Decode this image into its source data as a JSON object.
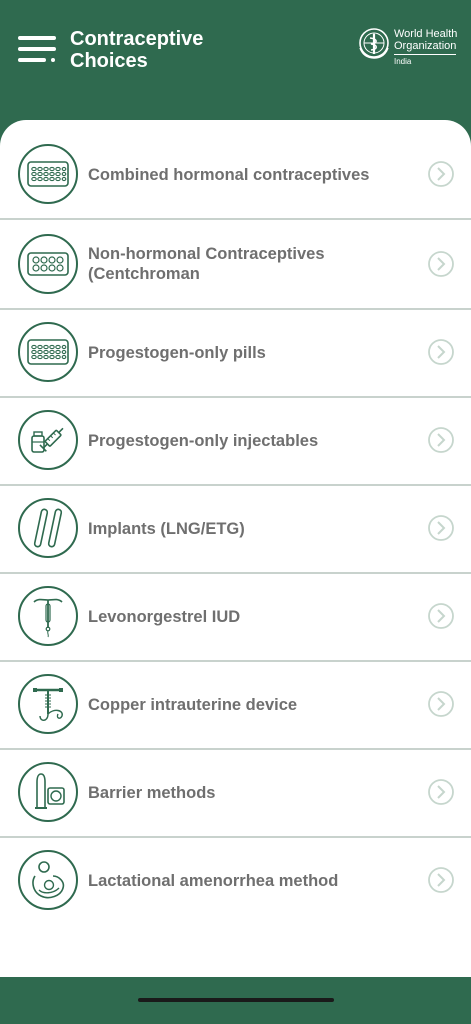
{
  "header": {
    "title_line1": "Contraceptive",
    "title_line2": "Choices",
    "org_name_line1": "World Health",
    "org_name_line2": "Organization",
    "org_country": "India"
  },
  "items": [
    {
      "label": "Combined hormonal contraceptives",
      "icon": "pill-pack-icon"
    },
    {
      "label": "Non-hormonal Contraceptives (Centchroman",
      "icon": "tablet-strip-icon"
    },
    {
      "label": "Progestogen-only pills",
      "icon": "pill-pack-icon"
    },
    {
      "label": "Progestogen-only injectables",
      "icon": "syringe-vial-icon"
    },
    {
      "label": "Implants (LNG/ETG)",
      "icon": "implant-rods-icon"
    },
    {
      "label": "Levonorgestrel IUD",
      "icon": "iud-icon"
    },
    {
      "label": "Copper intrauterine device",
      "icon": "copper-iud-icon"
    },
    {
      "label": "Barrier methods",
      "icon": "condom-icon"
    },
    {
      "label": "Lactational amenorrhea method",
      "icon": "breastfeeding-icon"
    }
  ],
  "colors": {
    "brand": "#2f6a4f",
    "text": "#6f6f6f",
    "chevron": "#c6d6cd"
  }
}
